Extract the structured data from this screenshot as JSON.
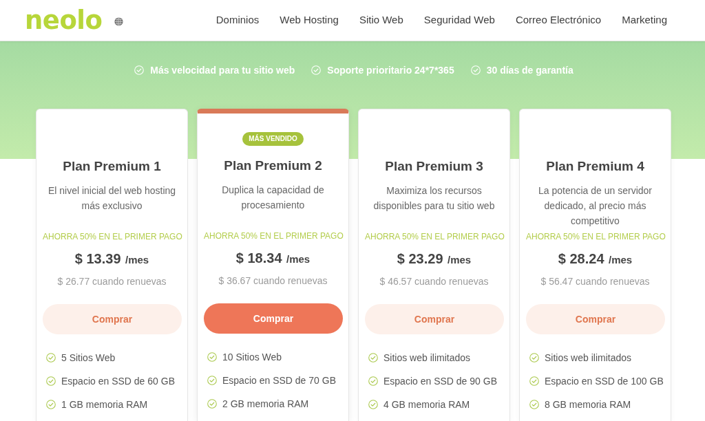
{
  "header": {
    "logo": "neolo",
    "nav": [
      "Dominios",
      "Web Hosting",
      "Sitio Web",
      "Seguridad Web",
      "Correo Electrónico",
      "Marketing"
    ]
  },
  "highlights": [
    "Más velocidad para tu sitio web",
    "Soporte prioritario 24*7*365",
    "30 días de garantía"
  ],
  "plans": [
    {
      "featured": false,
      "title": "Plan Premium 1",
      "description": "El nivel inicial del web hosting más exclusivo",
      "promo": "AHORRA 50% EN EL PRIMER PAGO",
      "price": "$ 13.39",
      "period": "/mes",
      "renewal": "$ 26.77 cuando renuevas",
      "button": "Comprar",
      "features": [
        "5 Sitios Web",
        "Espacio en SSD de 60 GB",
        "1 GB memoria RAM"
      ]
    },
    {
      "featured": true,
      "badge": "MÁS VENDIDO",
      "title": "Plan Premium 2",
      "description": "Duplica la capacidad de procesamiento",
      "promo": "AHORRA 50% EN EL PRIMER PAGO",
      "price": "$ 18.34",
      "period": "/mes",
      "renewal": "$ 36.67 cuando renuevas",
      "button": "Comprar",
      "features": [
        "10 Sitios Web",
        "Espacio en SSD de 70 GB",
        "2 GB memoria RAM"
      ]
    },
    {
      "featured": false,
      "title": "Plan Premium 3",
      "description": "Maximiza los recursos disponibles para tu sitio web",
      "promo": "AHORRA 50% EN EL PRIMER PAGO",
      "price": "$ 23.29",
      "period": "/mes",
      "renewal": "$ 46.57 cuando renuevas",
      "button": "Comprar",
      "features": [
        "Sitios web ilimitados",
        "Espacio en SSD de 90 GB",
        "4 GB memoria RAM"
      ]
    },
    {
      "featured": false,
      "title": "Plan Premium 4",
      "description": "La potencia de un servidor dedicado, al precio más competitivo",
      "promo": "AHORRA 50% EN EL PRIMER PAGO",
      "price": "$ 28.24",
      "period": "/mes",
      "renewal": "$ 56.47 cuando renuevas",
      "button": "Comprar",
      "features": [
        "Sitios web ilimitados",
        "Espacio en SSD de 100 GB",
        "8 GB memoria RAM"
      ]
    }
  ]
}
